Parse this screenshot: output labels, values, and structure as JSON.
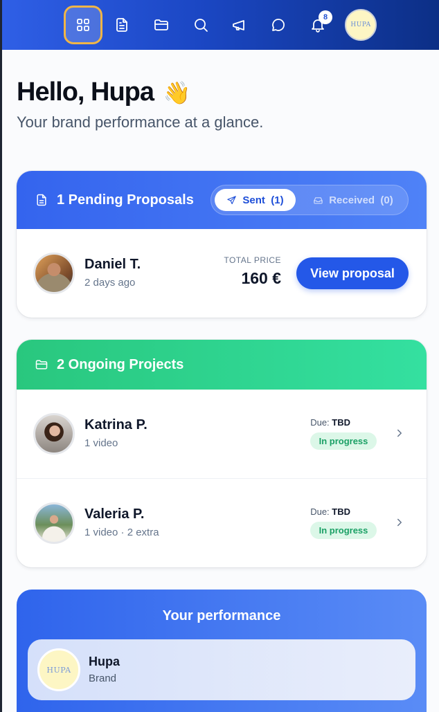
{
  "nav": {
    "items": [
      {
        "icon": "dashboard-grid-icon",
        "active": true
      },
      {
        "icon": "document-icon"
      },
      {
        "icon": "folder-icon"
      },
      {
        "icon": "search-icon"
      },
      {
        "icon": "megaphone-icon"
      },
      {
        "icon": "chat-bubble-icon"
      },
      {
        "icon": "bell-icon"
      }
    ],
    "notification_count": "8",
    "avatar_text": "HUPA",
    "active_border_color": "#f0b547"
  },
  "header": {
    "greeting": "Hello, Hupa",
    "wave_emoji": "👋",
    "subtitle": "Your brand performance at a glance."
  },
  "proposals": {
    "title": "1 Pending Proposals",
    "tabs": {
      "sent": "Sent  (1)",
      "received": "Received  (0)"
    },
    "items": [
      {
        "name": "Daniel T.",
        "time": "2 days ago",
        "price_label": "TOTAL PRICE",
        "price": "160 €",
        "action": "View proposal"
      }
    ]
  },
  "projects": {
    "title": "2 Ongoing Projects",
    "items": [
      {
        "name": "Katrina P.",
        "detail": "1 video",
        "due_label": "Due: ",
        "due_value": "TBD",
        "status": "In progress"
      },
      {
        "name": "Valeria P.",
        "detail": "1 video · 2 extra",
        "due_label": "Due: ",
        "due_value": "TBD",
        "status": "In progress"
      }
    ]
  },
  "performance": {
    "title": "Your performance",
    "brand_logo_text": "HUPA",
    "brand_name": "Hupa",
    "brand_type": "Brand"
  },
  "colors": {
    "primary": "#2458e8",
    "success": "#29c77e",
    "status_bg": "#dcf7e8",
    "status_text": "#1aa065"
  }
}
